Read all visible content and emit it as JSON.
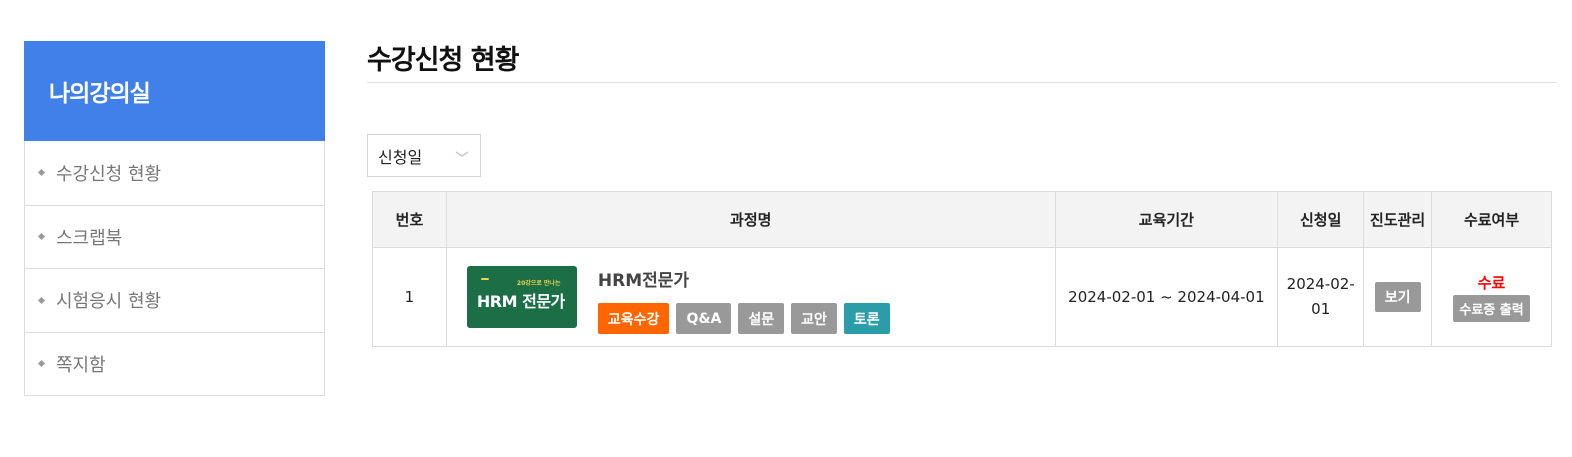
{
  "sidebar": {
    "title": "나의강의실",
    "items": [
      {
        "label": "수강신청 현황"
      },
      {
        "label": "스크랩북"
      },
      {
        "label": "시험응시 현황"
      },
      {
        "label": "쪽지함"
      }
    ]
  },
  "main": {
    "title": "수강신청 현황",
    "sort": {
      "selected": "신청일"
    },
    "table": {
      "headers": [
        "번호",
        "과정명",
        "교육기간",
        "신청일",
        "진도관리",
        "수료여부"
      ],
      "rows": [
        {
          "no": "1",
          "course": {
            "thumb": {
              "line1": "",
              "pill": "",
              "tagline": "20강으로 만나는",
              "title": "HRM 전문가",
              "footer": ""
            },
            "title": "HRM전문가",
            "buttons": [
              "교육수강",
              "Q&A",
              "설문",
              "교안",
              "토론"
            ]
          },
          "period": "2024-02-01 ~ 2024-04-01",
          "apply_date_line1": "2024-02-",
          "apply_date_line2": "01",
          "progress_btn": "보기",
          "status": "수료",
          "cert_btn": "수료증 출력"
        }
      ]
    }
  },
  "colors": {
    "sidebar_head": "#4080e8",
    "btn_orange": "#ff6600",
    "btn_gray": "#999999",
    "btn_teal": "#2a9da9",
    "status_red": "#ff0000"
  },
  "icons": {
    "sort_select": "chevron-down-icon",
    "sidebar_bullet": "diamond-bullet-icon"
  }
}
